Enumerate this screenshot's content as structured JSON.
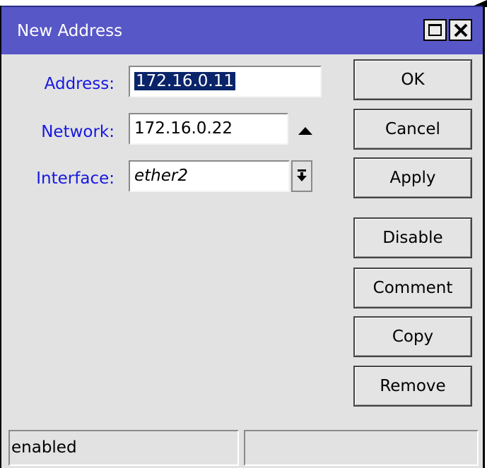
{
  "window": {
    "title": "New Address"
  },
  "form": {
    "address_label": "Address:",
    "address_value": "172.16.0.11",
    "network_label": "Network:",
    "network_value": "172.16.0.22",
    "interface_label": "Interface:",
    "interface_value": "ether2"
  },
  "buttons": {
    "ok": "OK",
    "cancel": "Cancel",
    "apply": "Apply",
    "disable": "Disable",
    "comment": "Comment",
    "copy": "Copy",
    "remove": "Remove"
  },
  "status": {
    "state": "enabled",
    "extra": ""
  },
  "colors": {
    "titlebar": "#5757c7",
    "label_text": "#1818e0",
    "window_bg": "#e2e2e2",
    "selection": "#0a246a"
  },
  "icons": [
    "maximize-icon",
    "close-icon",
    "arrow-up-icon",
    "dropdown-arrow-icon"
  ]
}
